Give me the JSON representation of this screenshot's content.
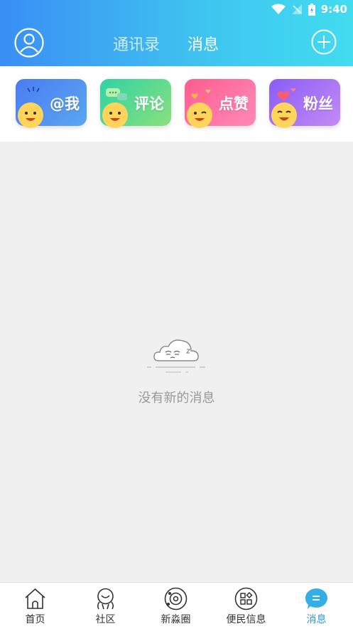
{
  "status_bar": {
    "time": "9:40",
    "icons": [
      "wifi-icon",
      "signal-icon",
      "battery-icon"
    ]
  },
  "header": {
    "tabs": [
      {
        "label": "通讯录",
        "active": false
      },
      {
        "label": "消息",
        "active": true
      }
    ],
    "left_icon": "user-avatar-icon",
    "right_icon": "add-circle-icon"
  },
  "quick_actions": [
    {
      "label": "@我",
      "icon": "mention-emoji-icon"
    },
    {
      "label": "评论",
      "icon": "comment-emoji-icon"
    },
    {
      "label": "点赞",
      "icon": "like-emoji-icon"
    },
    {
      "label": "粉丝",
      "icon": "fans-emoji-icon"
    }
  ],
  "empty_state": {
    "text": "没有新的消息",
    "icon": "sleepy-cloud-icon"
  },
  "bottom_nav": [
    {
      "label": "首页",
      "icon": "home-icon",
      "active": false
    },
    {
      "label": "社区",
      "icon": "community-icon",
      "active": false
    },
    {
      "label": "新淼圈",
      "icon": "circle-icon",
      "active": false
    },
    {
      "label": "便民信息",
      "icon": "apps-icon",
      "active": false
    },
    {
      "label": "消息",
      "icon": "message-icon",
      "active": true
    }
  ],
  "colors": {
    "header_gradient_start": "#3a8ef4",
    "header_gradient_end": "#42dcef",
    "active_tab": "#2d9cdb"
  }
}
